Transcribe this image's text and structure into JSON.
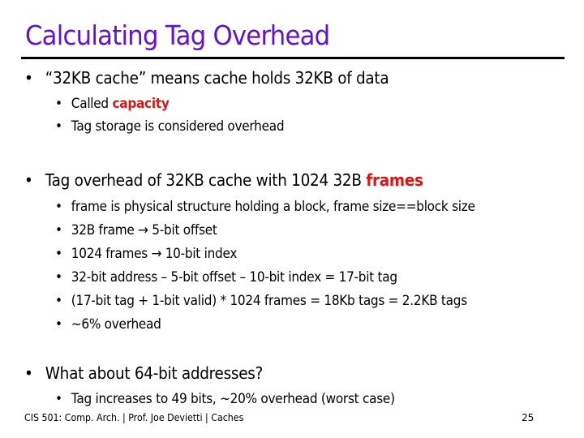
{
  "slide": {
    "title": "Calculating Tag Overhead",
    "bullet_char": "•",
    "sections": [
      {
        "text": "“32KB cache” means cache holds 32KB of data",
        "sub": [
          {
            "prefix": "Called ",
            "highlight": "capacity"
          },
          {
            "text": "Tag storage is considered overhead"
          }
        ]
      },
      {
        "prefix": "Tag overhead of 32KB cache with 1024 32B ",
        "highlight": "frames",
        "sub": [
          {
            "text": "frame is physical structure holding a block, frame size==block size"
          },
          {
            "text": "32B frame → 5-bit offset"
          },
          {
            "text": "1024 frames → 10-bit index"
          },
          {
            "text": "32-bit address – 5-bit offset – 10-bit index = 17-bit tag"
          },
          {
            "text": "(17-bit tag + 1-bit valid) * 1024 frames = 18Kb tags = 2.2KB tags"
          },
          {
            "text": "~6% overhead"
          }
        ]
      },
      {
        "text": "What about 64-bit addresses?",
        "sub": [
          {
            "text": "Tag increases to 49 bits, ~20% overhead (worst case)"
          }
        ]
      }
    ],
    "footer": "CIS 501: Comp. Arch.  |  Prof. Joe Devietti  |  Caches",
    "page_number": "25",
    "colors": {
      "title": "#6211d6",
      "highlight": "#d71818",
      "text": "#000000"
    }
  }
}
